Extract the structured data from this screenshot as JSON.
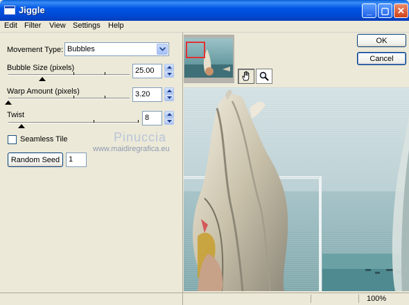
{
  "window": {
    "title": "Jiggle"
  },
  "titlebar_buttons": [
    "_",
    "▢",
    "✕"
  ],
  "menu": [
    "Edit",
    "Filter",
    "View",
    "Settings",
    "Help"
  ],
  "movement_type": {
    "label": "Movement Type:",
    "value": "Bubbles"
  },
  "bubble_size": {
    "label": "Bubble Size (pixels)",
    "value": "25.00",
    "level": 0.28
  },
  "warp_amount": {
    "label": "Warp Amount (pixels)",
    "value": "3.20",
    "level": 0.0
  },
  "twist": {
    "label": "Twist",
    "value": "8",
    "level": 0.08
  },
  "seamless_tile": {
    "label": "Seamless Tile",
    "checked": false
  },
  "random_seed": {
    "button": "Random Seed",
    "value": "1"
  },
  "watermark": {
    "line1": "Pinuccia",
    "line2": "www.maidiregrafica.eu"
  },
  "buttons": {
    "ok": "OK",
    "cancel": "Cancel"
  },
  "tools": [
    "hand-icon",
    "magnifier-icon"
  ],
  "status": {
    "zoom": "100%"
  }
}
